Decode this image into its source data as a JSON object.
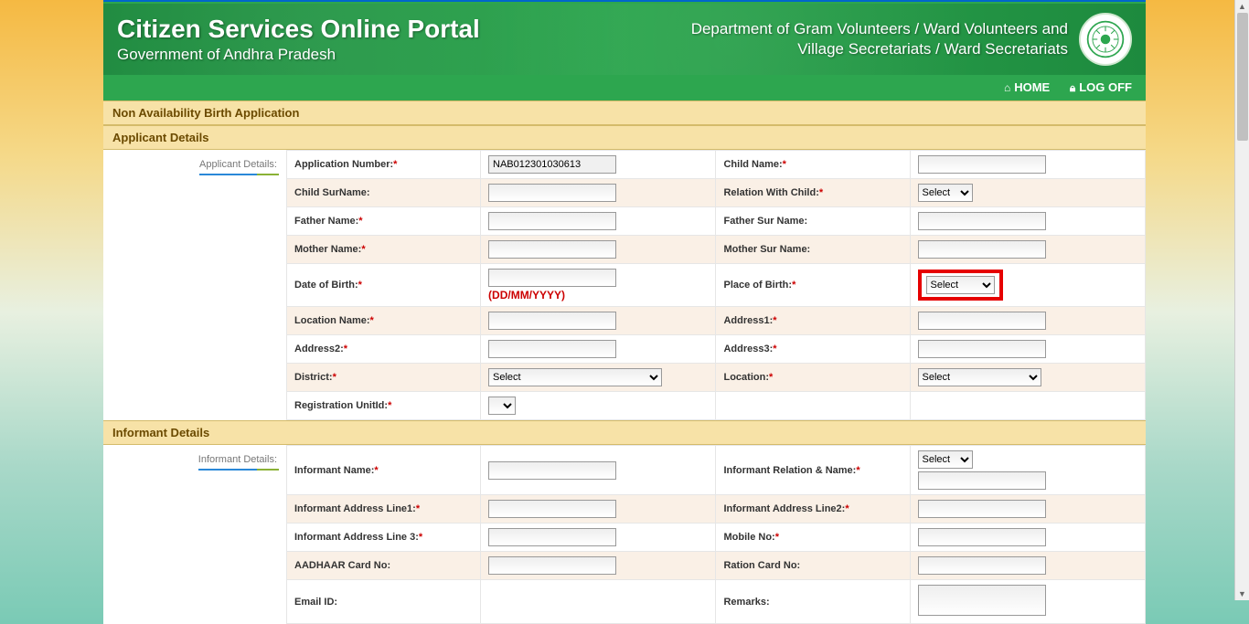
{
  "header": {
    "title": "Citizen Services Online Portal",
    "subtitle": "Government of Andhra Pradesh",
    "dept_line1": "Department of Gram Volunteers / Ward Volunteers and",
    "dept_line2": "Village Secretariats / Ward Secretariats"
  },
  "nav": {
    "home": "HOME",
    "logoff": "LOG OFF"
  },
  "sections": {
    "page_title": "Non Availability Birth Application",
    "applicant_details": "Applicant Details",
    "informant_details": "Informant Details"
  },
  "side_labels": {
    "applicant": "Applicant Details:",
    "informant": "Informant Details:"
  },
  "fields": {
    "application_number": "Application Number:",
    "application_number_value": "NAB012301030613",
    "child_name": "Child Name:",
    "child_surname": "Child SurName:",
    "relation_with_child": "Relation With Child:",
    "father_name": "Father Name:",
    "father_surname": "Father Sur Name:",
    "mother_name": "Mother Name:",
    "mother_surname": "Mother Sur Name:",
    "dob": "Date of Birth:",
    "dob_hint": "(DD/MM/YYYY)",
    "place_of_birth": "Place of Birth:",
    "location_name": "Location Name:",
    "address1": "Address1:",
    "address2": "Address2:",
    "address3": "Address3:",
    "district": "District:",
    "location": "Location:",
    "registration_unit": "Registration UnitId:",
    "informant_name": "Informant Name:",
    "informant_relation": "Informant Relation & Name:",
    "informant_addr1": "Informant Address Line1:",
    "informant_addr2": "Informant Address Line2:",
    "informant_addr3": "Informant Address Line 3:",
    "mobile_no": "Mobile No:",
    "aadhaar": "AADHAAR Card No:",
    "ration": "Ration Card No:",
    "email": "Email ID:",
    "remarks": "Remarks:"
  },
  "select_default": "Select"
}
